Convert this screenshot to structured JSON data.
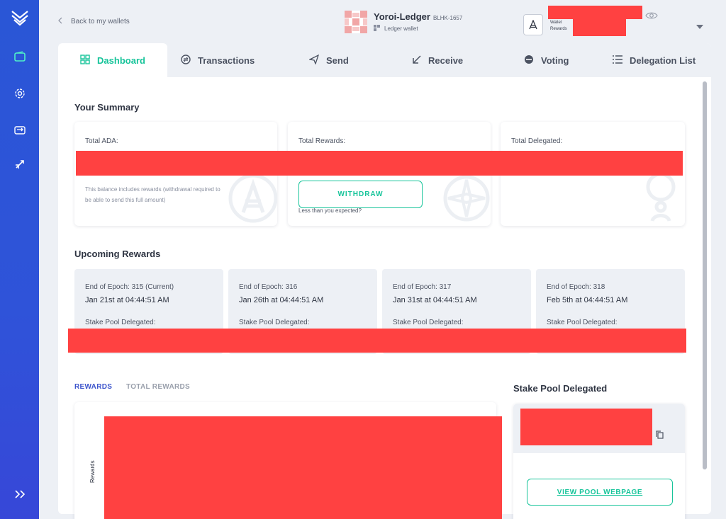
{
  "nav": {
    "back_label": "Back to my wallets"
  },
  "wallet": {
    "name": "Yoroi-Ledger",
    "code": "BLHK-1657",
    "type": "Ledger wallet",
    "balance_label": "Wallet",
    "rewards_label": "Rewards"
  },
  "tabs": [
    {
      "label": "Dashboard",
      "icon": "dashboard-icon",
      "active": true
    },
    {
      "label": "Transactions",
      "icon": "transactions-icon"
    },
    {
      "label": "Send",
      "icon": "send-icon"
    },
    {
      "label": "Receive",
      "icon": "receive-icon"
    },
    {
      "label": "Voting",
      "icon": "voting-icon"
    },
    {
      "label": "Delegation List",
      "icon": "list-icon"
    }
  ],
  "summary": {
    "title": "Your Summary",
    "total_ada_label": "Total ADA:",
    "total_ada_note": "This balance includes rewards (withdrawal required to be able to send this full amount)",
    "total_rewards_label": "Total Rewards:",
    "withdraw_label": "WITHDRAW",
    "less_than_expected": "Less than you expected?",
    "total_delegated_label": "Total Delegated:"
  },
  "upcoming": {
    "title": "Upcoming Rewards",
    "epochs": [
      {
        "line": "End of Epoch:  315 (Current)",
        "date": "Jan 21st at 04:44:51 AM",
        "pool_label": "Stake Pool Delegated:"
      },
      {
        "line": "End of Epoch:  316",
        "date": "Jan 26th at 04:44:51 AM",
        "pool_label": "Stake Pool Delegated:"
      },
      {
        "line": "End of Epoch:  317",
        "date": "Jan 31st at 04:44:51 AM",
        "pool_label": "Stake Pool Delegated:"
      },
      {
        "line": "End of Epoch:  318",
        "date": "Feb 5th at 04:44:51 AM",
        "pool_label": "Stake Pool Delegated:"
      }
    ]
  },
  "rewards_section": {
    "tab_rewards": "REWARDS",
    "tab_total_rewards": "TOTAL REWARDS",
    "y_axis_label": "Rewards"
  },
  "stake_pool": {
    "title": "Stake Pool Delegated",
    "view_button": "VIEW POOL WEBPAGE"
  },
  "colors": {
    "accent": "#17c49a",
    "sidebar": "#2f53d9",
    "redaction": "#ff4141"
  }
}
